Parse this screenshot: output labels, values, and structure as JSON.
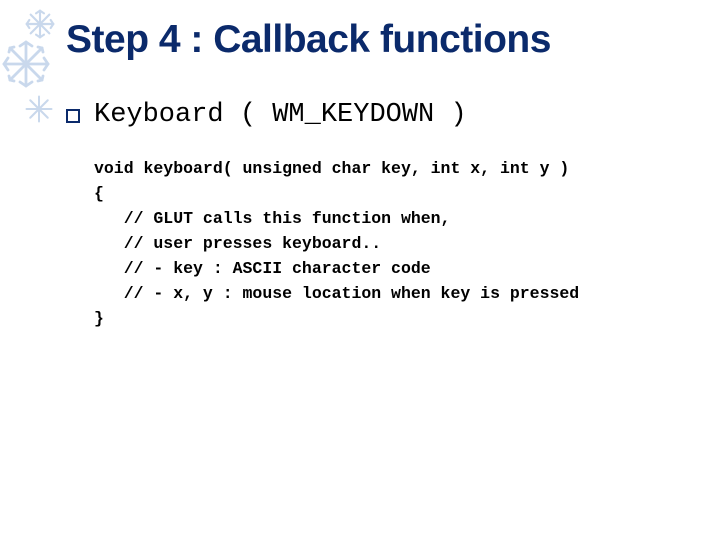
{
  "title": "Step 4 : Callback functions",
  "bullet": "Keyboard ( WM_KEYDOWN )",
  "code": {
    "l1": "void keyboard( unsigned char key, int x, int y )",
    "l2": "{",
    "l3": "   // GLUT calls this function when,",
    "l4": "   // user presses keyboard..",
    "l5": "   // - key : ASCII character code",
    "l6": "   // - x, y : mouse location when key is pressed",
    "l7": "}"
  }
}
